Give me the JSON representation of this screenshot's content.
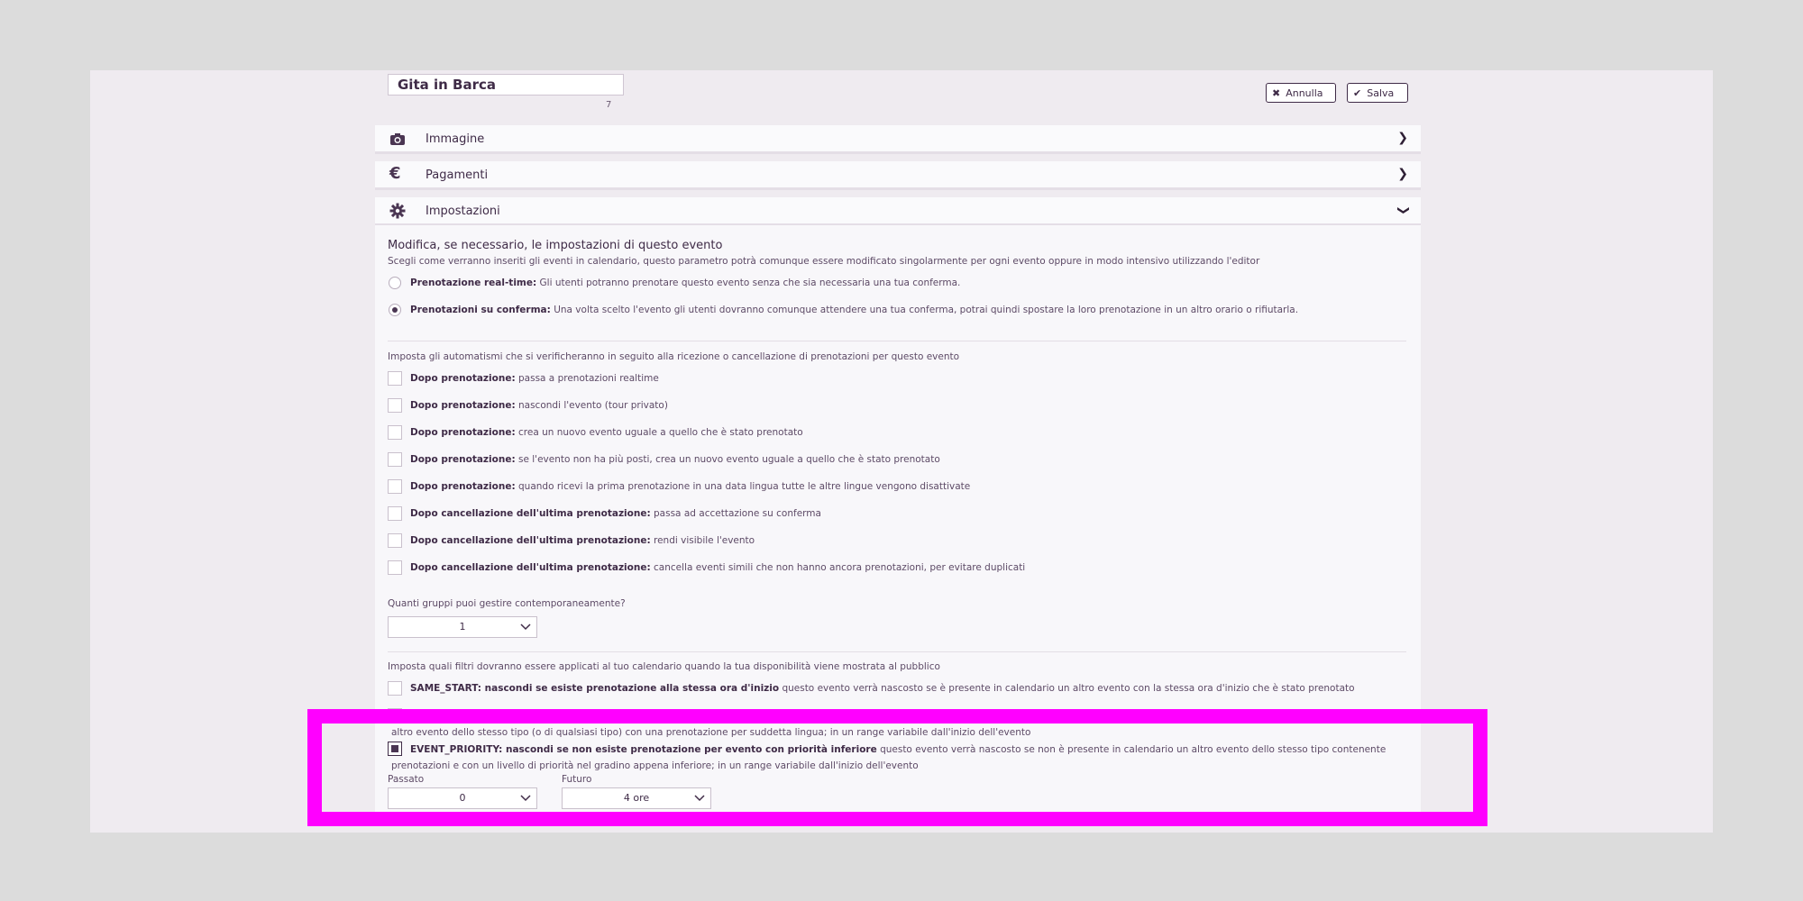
{
  "header": {
    "event_title": "Gita in Barca",
    "char_count": "7",
    "cancel_label": "Annulla",
    "save_label": "Salva"
  },
  "panels": [
    {
      "label": "Immagine",
      "icon": "camera-icon",
      "state": "collapsed"
    },
    {
      "label": "Pagamenti",
      "icon": "euro-icon",
      "state": "collapsed"
    },
    {
      "label": "Impostazioni",
      "icon": "gear-icon",
      "state": "expanded"
    }
  ],
  "settings": {
    "heading": "Modifica, se necessario, le impostazioni di questo evento",
    "booking_mode_hint": "Scegli come verranno inseriti gli eventi in calendario, questo parametro potrà comunque essere modificato singolarmente per ogni evento oppure in modo intensivo utilizzando l'editor",
    "booking_modes": [
      {
        "label": "Prenotazione real-time:",
        "desc": "Gli utenti potranno prenotare questo evento senza che sia necessaria una tua conferma.",
        "selected": false
      },
      {
        "label": "Prenotazioni su conferma:",
        "desc": "Una volta scelto l'evento gli utenti dovranno comunque attendere una tua conferma, potrai quindi spostare la loro prenotazione in un altro orario o rifiutarla.",
        "selected": true
      }
    ],
    "automation_hint": "Imposta gli automatismi che si verificheranno in seguito alla ricezione o cancellazione di prenotazioni per questo evento",
    "automations": [
      {
        "label": "Dopo prenotazione:",
        "desc": "passa a prenotazioni realtime",
        "checked": false
      },
      {
        "label": "Dopo prenotazione:",
        "desc": "nascondi l'evento (tour privato)",
        "checked": false
      },
      {
        "label": "Dopo prenotazione:",
        "desc": "crea un nuovo evento uguale a quello che è stato prenotato",
        "checked": false
      },
      {
        "label": "Dopo prenotazione:",
        "desc": "se l'evento non ha più posti, crea un nuovo evento uguale a quello che è stato prenotato",
        "checked": false
      },
      {
        "label": "Dopo prenotazione:",
        "desc": "quando ricevi la prima prenotazione in una data lingua tutte le altre lingue vengono disattivate",
        "checked": false
      },
      {
        "label": "Dopo cancellazione dell'ultima prenotazione:",
        "desc": "passa ad accettazione su conferma",
        "checked": false
      },
      {
        "label": "Dopo cancellazione dell'ultima prenotazione:",
        "desc": "rendi visibile l'evento",
        "checked": false
      },
      {
        "label": "Dopo cancellazione dell'ultima prenotazione:",
        "desc": "cancella eventi simili che non hanno ancora prenotazioni, per evitare duplicati",
        "checked": false
      }
    ],
    "groups_question": "Quanti gruppi puoi gestire contemporaneamente?",
    "groups_value": "1",
    "filters_hint": "Imposta quali filtri dovranno essere applicati al tuo calendario quando la tua disponibilità viene mostrata al pubblico",
    "filters": [
      {
        "label": "SAME_START: nascondi se esiste prenotazione alla stessa ora d'inizio",
        "desc": "questo evento verrà nascosto se è presente in calendario un altro evento con la stessa ora d'inizio che è stato prenotato",
        "checked": false
      },
      {
        "label": "SAME_LANGUAGE: nascondi (o mostra) se esiste una prenotazione per la stessa lingua",
        "desc": "questo evento verrà nascosto (o mostrato) per una determinata lingua richiesta se è presente in calendario un altro evento dello stesso tipo (o di qualsiasi tipo) con una prenotazione per suddetta lingua; in un range variabile dall'inizio dell'evento",
        "checked": false
      },
      {
        "label": "EVENT_PRIORITY: nascondi se non esiste prenotazione per evento con priorità inferiore",
        "desc": "questo evento verrà nascosto se non è presente in calendario un altro evento dello stesso tipo contenente prenotazioni e con un livello di priorità nel gradino appena inferiore; in un range variabile dall'inizio dell'evento",
        "checked": true
      }
    ],
    "range": {
      "past_label": "Passato",
      "past_value": "0",
      "future_label": "Futuro",
      "future_value": "4 ore"
    }
  },
  "colors": {
    "highlight": "#ff00ff",
    "text": "#3f2b47",
    "background": "#efebf0"
  }
}
